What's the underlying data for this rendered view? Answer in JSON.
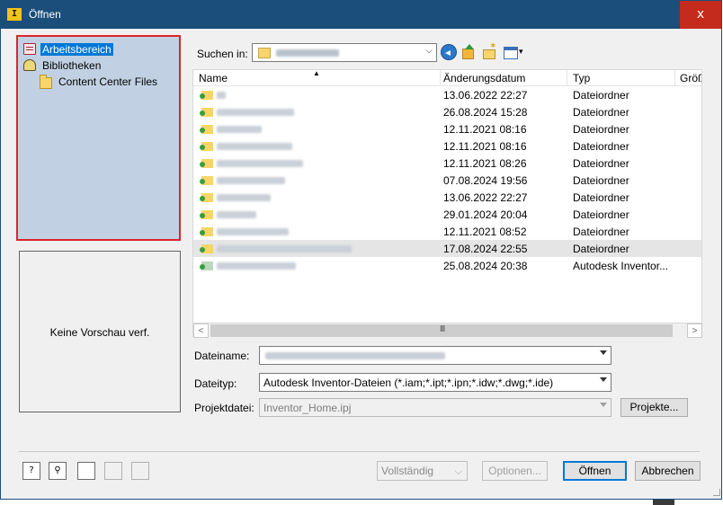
{
  "window": {
    "title": "Öffnen",
    "app_icon": "I",
    "close_label": "x"
  },
  "nav": {
    "items": [
      {
        "label": "Arbeitsbereich",
        "icon": "workspace-book-icon",
        "selected": true
      },
      {
        "label": "Bibliotheken",
        "icon": "library-icon",
        "selected": false
      },
      {
        "label": "Content Center Files",
        "icon": "folder-icon",
        "selected": false
      }
    ]
  },
  "preview": {
    "text": "Keine Vorschau verf."
  },
  "lookin": {
    "label": "Suchen in:"
  },
  "list": {
    "columns": [
      "Name",
      "Änderungsdatum",
      "Typ",
      "Größ"
    ],
    "rows": [
      {
        "date": "13.06.2022 22:27",
        "type": "Dateiordner"
      },
      {
        "date": "26.08.2024 15:28",
        "type": "Dateiordner"
      },
      {
        "date": "12.11.2021 08:16",
        "type": "Dateiordner"
      },
      {
        "date": "12.11.2021 08:16",
        "type": "Dateiordner"
      },
      {
        "date": "12.11.2021 08:26",
        "type": "Dateiordner"
      },
      {
        "date": "07.08.2024 19:56",
        "type": "Dateiordner"
      },
      {
        "date": "13.06.2022 22:27",
        "type": "Dateiordner"
      },
      {
        "date": "29.01.2024 20:04",
        "type": "Dateiordner"
      },
      {
        "date": "12.11.2021 08:52",
        "type": "Dateiordner"
      },
      {
        "date": "17.08.2024 22:55",
        "type": "Dateiordner"
      },
      {
        "date": "25.08.2024 20:38",
        "type": "Autodesk Inventor..."
      }
    ],
    "scroll_grip": "III",
    "scroll_left": "<",
    "scroll_right": ">"
  },
  "form": {
    "filename_label": "Dateiname:",
    "filetype_label": "Dateityp:",
    "filetype_value": "Autodesk Inventor-Dateien (*.iam;*.ipt;*.ipn;*.idw;*.dwg;*.ide)",
    "project_label": "Projektdatei:",
    "project_value": "Inventor_Home.ipj",
    "projects_button": "Projekte..."
  },
  "footer": {
    "mode_value": "Vollständig",
    "options_button": "Optionen...",
    "open_button": "Öffnen",
    "cancel_button": "Abbrechen",
    "help_icon": "?",
    "find_icon": "⚲"
  },
  "colors": {
    "titlebar": "#1b4e7a",
    "close": "#c42b1c",
    "nav_bg": "#c1d1e3",
    "selection": "#0078d7",
    "highlight_border": "#d9262c"
  }
}
